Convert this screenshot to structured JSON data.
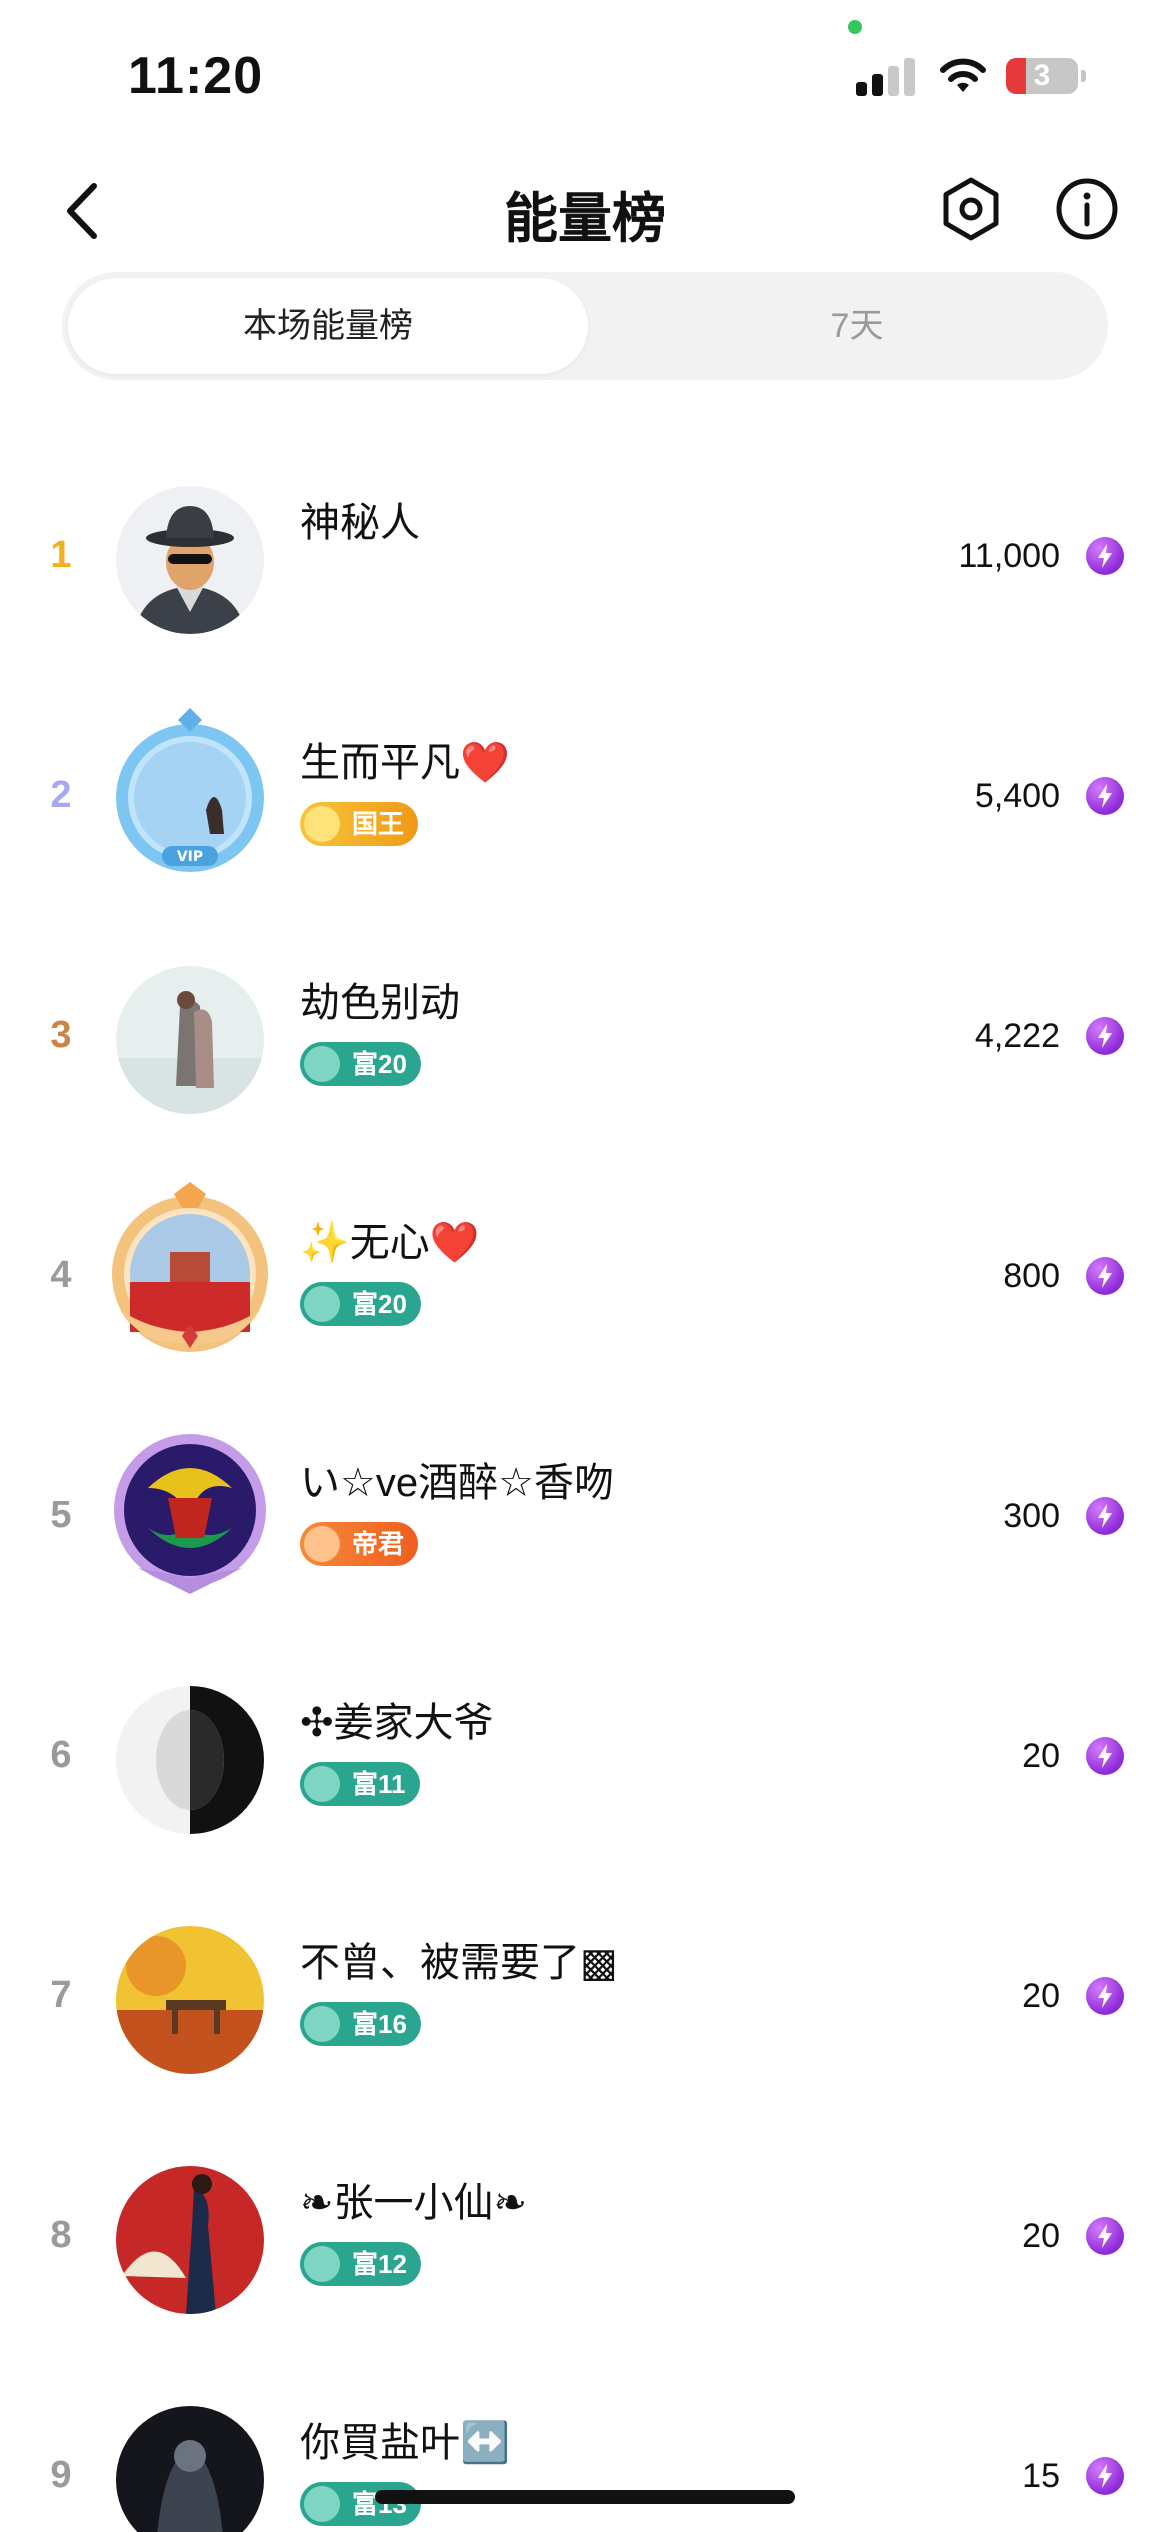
{
  "status_bar": {
    "time": "11:20",
    "battery_level": "3",
    "battery_color": "#e5393b"
  },
  "header": {
    "title": "能量榜",
    "back_icon": "chevron-left-icon",
    "settings_icon": "hexagon-settings-icon",
    "info_icon": "info-icon"
  },
  "tabs": [
    {
      "label": "本场能量榜",
      "active": true
    },
    {
      "label": "7天",
      "active": false
    }
  ],
  "colors": {
    "rank_gold": "#f2b01e",
    "rank_silver": "#a8a8f0",
    "rank_bronze": "#c8864a",
    "rank_default": "#9a9a9a",
    "badge_green": "#2aa58f",
    "badge_gold": "#f0a21c",
    "badge_orange": "#f2772a",
    "energy_purple": "#9b34e0"
  },
  "leaderboard": [
    {
      "rank": "1",
      "name": "神秘人",
      "badge": "",
      "score": "11,000"
    },
    {
      "rank": "2",
      "name": "生而平凡❤️",
      "badge": "国王",
      "score": "5,400"
    },
    {
      "rank": "3",
      "name": "劫色别动",
      "badge": "富20",
      "score": "4,222"
    },
    {
      "rank": "4",
      "name": "✨无心❤️",
      "badge": "富20",
      "score": "800"
    },
    {
      "rank": "5",
      "name": "い☆ve酒醉☆香吻",
      "badge": "帝君",
      "score": "300"
    },
    {
      "rank": "6",
      "name": "✣姜家大爷",
      "badge": "富11",
      "score": "20"
    },
    {
      "rank": "7",
      "name": "不曾、被需要了▩",
      "badge": "富16",
      "score": "20"
    },
    {
      "rank": "8",
      "name": "❧张一小仙❧",
      "badge": "富12",
      "score": "20"
    },
    {
      "rank": "9",
      "name": "你買盐叶↔️",
      "badge": "富13",
      "score": "15"
    }
  ]
}
